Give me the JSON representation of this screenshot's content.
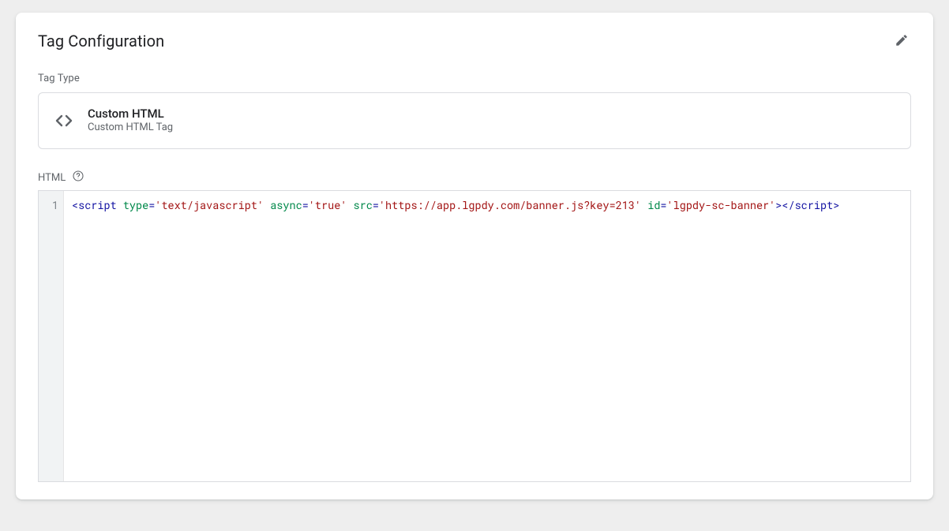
{
  "card": {
    "title": "Tag Configuration",
    "tag_type_label": "Tag Type",
    "tag_type": {
      "name": "Custom HTML",
      "description": "Custom HTML Tag"
    },
    "html_label": "HTML"
  },
  "code": {
    "line_numbers": [
      "1"
    ],
    "tokens": [
      {
        "t": "punc",
        "v": "<"
      },
      {
        "t": "tag",
        "v": "script"
      },
      {
        "t": "plain",
        "v": " "
      },
      {
        "t": "attr",
        "v": "type"
      },
      {
        "t": "punc",
        "v": "="
      },
      {
        "t": "str",
        "v": "'text/javascript'"
      },
      {
        "t": "plain",
        "v": " "
      },
      {
        "t": "attr",
        "v": "async"
      },
      {
        "t": "punc",
        "v": "="
      },
      {
        "t": "str",
        "v": "'true'"
      },
      {
        "t": "plain",
        "v": " "
      },
      {
        "t": "attr",
        "v": "src"
      },
      {
        "t": "punc",
        "v": "="
      },
      {
        "t": "str",
        "v": "'https://app.lgpdy.com/banner.js?key=213'"
      },
      {
        "t": "plain",
        "v": " "
      },
      {
        "t": "attr",
        "v": "id"
      },
      {
        "t": "punc",
        "v": "="
      },
      {
        "t": "str",
        "v": "'lgpdy-sc-banner'"
      },
      {
        "t": "punc",
        "v": ">"
      },
      {
        "t": "punc",
        "v": "</"
      },
      {
        "t": "tag",
        "v": "script"
      },
      {
        "t": "punc",
        "v": ">"
      }
    ]
  }
}
